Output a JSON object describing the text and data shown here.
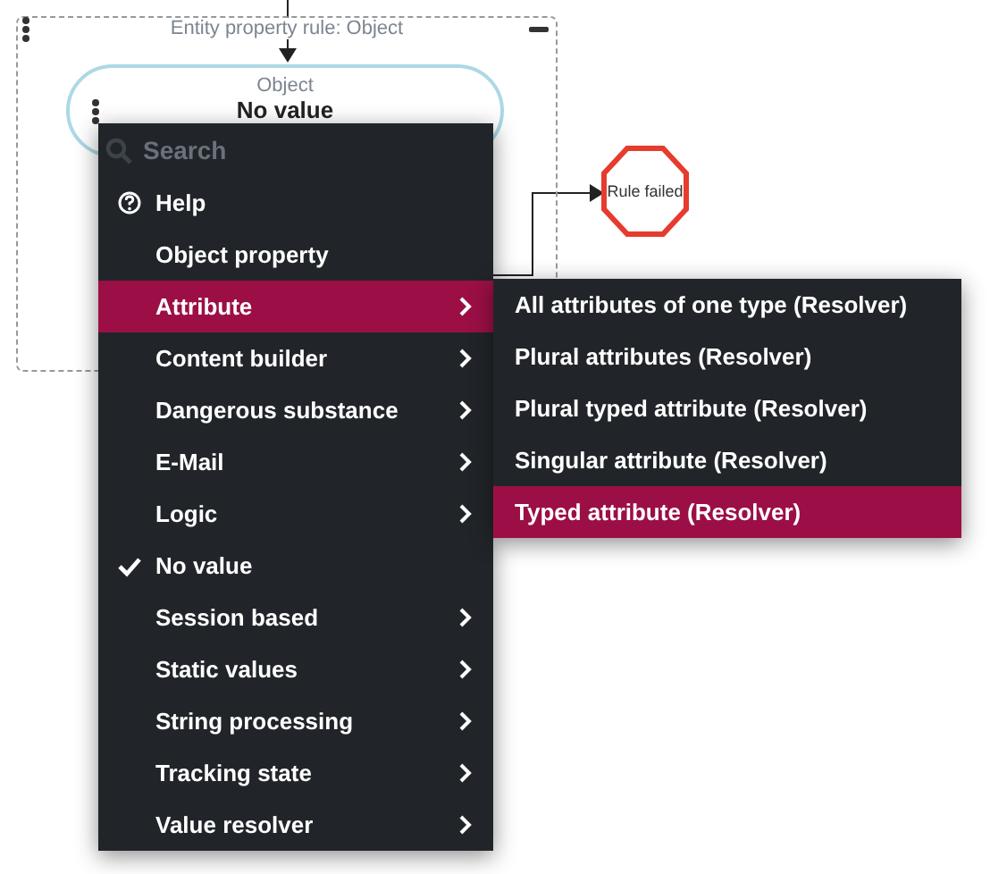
{
  "rule": {
    "title": "Entity property rule: Object",
    "node": {
      "label": "Object",
      "value": "No value"
    },
    "outcome": "Rule failed"
  },
  "menu": {
    "search": {
      "placeholder": "Search"
    },
    "items": [
      {
        "kind": "help",
        "label": "Help",
        "selected": false,
        "checked": false,
        "has_submenu": false
      },
      {
        "kind": "item",
        "label": "Object property",
        "selected": false,
        "checked": false,
        "has_submenu": false
      },
      {
        "kind": "item",
        "label": "Attribute",
        "selected": true,
        "checked": false,
        "has_submenu": true
      },
      {
        "kind": "item",
        "label": "Content builder",
        "selected": false,
        "checked": false,
        "has_submenu": true
      },
      {
        "kind": "item",
        "label": "Dangerous substance",
        "selected": false,
        "checked": false,
        "has_submenu": true
      },
      {
        "kind": "item",
        "label": "E-Mail",
        "selected": false,
        "checked": false,
        "has_submenu": true
      },
      {
        "kind": "item",
        "label": "Logic",
        "selected": false,
        "checked": false,
        "has_submenu": true
      },
      {
        "kind": "item",
        "label": "No value",
        "selected": false,
        "checked": true,
        "has_submenu": false
      },
      {
        "kind": "item",
        "label": "Session based",
        "selected": false,
        "checked": false,
        "has_submenu": true
      },
      {
        "kind": "item",
        "label": "Static values",
        "selected": false,
        "checked": false,
        "has_submenu": true
      },
      {
        "kind": "item",
        "label": "String processing",
        "selected": false,
        "checked": false,
        "has_submenu": true
      },
      {
        "kind": "item",
        "label": "Tracking state",
        "selected": false,
        "checked": false,
        "has_submenu": true
      },
      {
        "kind": "item",
        "label": "Value resolver",
        "selected": false,
        "checked": false,
        "has_submenu": true
      }
    ]
  },
  "submenu": {
    "items": [
      {
        "label": "All attributes of one type (Resolver)",
        "selected": false
      },
      {
        "label": "Plural attributes (Resolver)",
        "selected": false
      },
      {
        "label": "Plural typed attribute (Resolver)",
        "selected": false
      },
      {
        "label": "Singular attribute (Resolver)",
        "selected": false
      },
      {
        "label": "Typed attribute (Resolver)",
        "selected": true
      }
    ]
  }
}
